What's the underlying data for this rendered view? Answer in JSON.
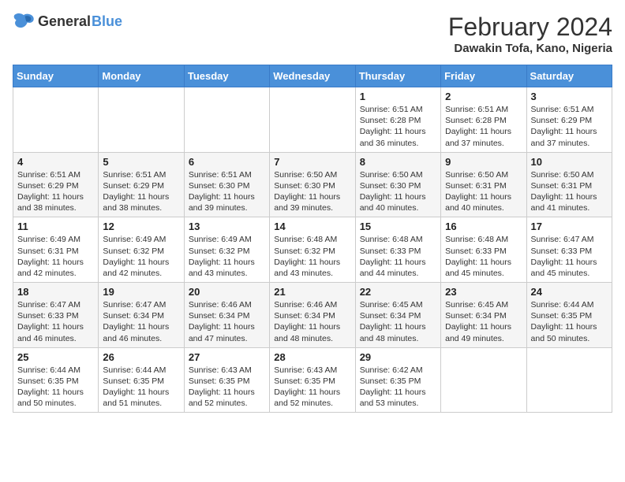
{
  "header": {
    "logo_general": "General",
    "logo_blue": "Blue",
    "month_year": "February 2024",
    "location": "Dawakin Tofa, Kano, Nigeria"
  },
  "days_of_week": [
    "Sunday",
    "Monday",
    "Tuesday",
    "Wednesday",
    "Thursday",
    "Friday",
    "Saturday"
  ],
  "weeks": [
    [
      {
        "day": "",
        "info": ""
      },
      {
        "day": "",
        "info": ""
      },
      {
        "day": "",
        "info": ""
      },
      {
        "day": "",
        "info": ""
      },
      {
        "day": "1",
        "info": "Sunrise: 6:51 AM\nSunset: 6:28 PM\nDaylight: 11 hours and 36 minutes."
      },
      {
        "day": "2",
        "info": "Sunrise: 6:51 AM\nSunset: 6:28 PM\nDaylight: 11 hours and 37 minutes."
      },
      {
        "day": "3",
        "info": "Sunrise: 6:51 AM\nSunset: 6:29 PM\nDaylight: 11 hours and 37 minutes."
      }
    ],
    [
      {
        "day": "4",
        "info": "Sunrise: 6:51 AM\nSunset: 6:29 PM\nDaylight: 11 hours and 38 minutes."
      },
      {
        "day": "5",
        "info": "Sunrise: 6:51 AM\nSunset: 6:29 PM\nDaylight: 11 hours and 38 minutes."
      },
      {
        "day": "6",
        "info": "Sunrise: 6:51 AM\nSunset: 6:30 PM\nDaylight: 11 hours and 39 minutes."
      },
      {
        "day": "7",
        "info": "Sunrise: 6:50 AM\nSunset: 6:30 PM\nDaylight: 11 hours and 39 minutes."
      },
      {
        "day": "8",
        "info": "Sunrise: 6:50 AM\nSunset: 6:30 PM\nDaylight: 11 hours and 40 minutes."
      },
      {
        "day": "9",
        "info": "Sunrise: 6:50 AM\nSunset: 6:31 PM\nDaylight: 11 hours and 40 minutes."
      },
      {
        "day": "10",
        "info": "Sunrise: 6:50 AM\nSunset: 6:31 PM\nDaylight: 11 hours and 41 minutes."
      }
    ],
    [
      {
        "day": "11",
        "info": "Sunrise: 6:49 AM\nSunset: 6:31 PM\nDaylight: 11 hours and 42 minutes."
      },
      {
        "day": "12",
        "info": "Sunrise: 6:49 AM\nSunset: 6:32 PM\nDaylight: 11 hours and 42 minutes."
      },
      {
        "day": "13",
        "info": "Sunrise: 6:49 AM\nSunset: 6:32 PM\nDaylight: 11 hours and 43 minutes."
      },
      {
        "day": "14",
        "info": "Sunrise: 6:48 AM\nSunset: 6:32 PM\nDaylight: 11 hours and 43 minutes."
      },
      {
        "day": "15",
        "info": "Sunrise: 6:48 AM\nSunset: 6:33 PM\nDaylight: 11 hours and 44 minutes."
      },
      {
        "day": "16",
        "info": "Sunrise: 6:48 AM\nSunset: 6:33 PM\nDaylight: 11 hours and 45 minutes."
      },
      {
        "day": "17",
        "info": "Sunrise: 6:47 AM\nSunset: 6:33 PM\nDaylight: 11 hours and 45 minutes."
      }
    ],
    [
      {
        "day": "18",
        "info": "Sunrise: 6:47 AM\nSunset: 6:33 PM\nDaylight: 11 hours and 46 minutes."
      },
      {
        "day": "19",
        "info": "Sunrise: 6:47 AM\nSunset: 6:34 PM\nDaylight: 11 hours and 46 minutes."
      },
      {
        "day": "20",
        "info": "Sunrise: 6:46 AM\nSunset: 6:34 PM\nDaylight: 11 hours and 47 minutes."
      },
      {
        "day": "21",
        "info": "Sunrise: 6:46 AM\nSunset: 6:34 PM\nDaylight: 11 hours and 48 minutes."
      },
      {
        "day": "22",
        "info": "Sunrise: 6:45 AM\nSunset: 6:34 PM\nDaylight: 11 hours and 48 minutes."
      },
      {
        "day": "23",
        "info": "Sunrise: 6:45 AM\nSunset: 6:34 PM\nDaylight: 11 hours and 49 minutes."
      },
      {
        "day": "24",
        "info": "Sunrise: 6:44 AM\nSunset: 6:35 PM\nDaylight: 11 hours and 50 minutes."
      }
    ],
    [
      {
        "day": "25",
        "info": "Sunrise: 6:44 AM\nSunset: 6:35 PM\nDaylight: 11 hours and 50 minutes."
      },
      {
        "day": "26",
        "info": "Sunrise: 6:44 AM\nSunset: 6:35 PM\nDaylight: 11 hours and 51 minutes."
      },
      {
        "day": "27",
        "info": "Sunrise: 6:43 AM\nSunset: 6:35 PM\nDaylight: 11 hours and 52 minutes."
      },
      {
        "day": "28",
        "info": "Sunrise: 6:43 AM\nSunset: 6:35 PM\nDaylight: 11 hours and 52 minutes."
      },
      {
        "day": "29",
        "info": "Sunrise: 6:42 AM\nSunset: 6:35 PM\nDaylight: 11 hours and 53 minutes."
      },
      {
        "day": "",
        "info": ""
      },
      {
        "day": "",
        "info": ""
      }
    ]
  ]
}
